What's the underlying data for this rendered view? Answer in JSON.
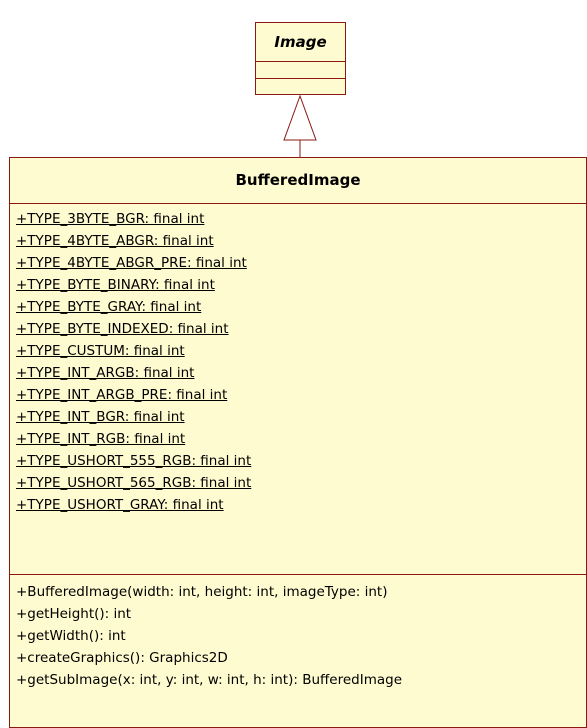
{
  "parent_class": {
    "name": "Image",
    "attributes": [],
    "operations": []
  },
  "child_class": {
    "name": "BufferedImage",
    "attributes": [
      "+TYPE_3BYTE_BGR: final int",
      "+TYPE_4BYTE_ABGR: final int",
      "+TYPE_4BYTE_ABGR_PRE: final int",
      "+TYPE_BYTE_BINARY: final int",
      "+TYPE_BYTE_GRAY: final int",
      "+TYPE_BYTE_INDEXED: final int",
      "+TYPE_CUSTUM: final int",
      "+TYPE_INT_ARGB: final int",
      "+TYPE_INT_ARGB_PRE: final int",
      "+TYPE_INT_BGR: final int",
      "+TYPE_INT_RGB: final int",
      "+TYPE_USHORT_555_RGB: final int",
      "+TYPE_USHORT_565_RGB: final int",
      "+TYPE_USHORT_GRAY: final int"
    ],
    "operations": [
      "+BufferedImage(width: int, height: int, imageType: int)",
      "+getHeight(): int",
      "+getWidth(): int",
      "+createGraphics(): Graphics2D",
      "+getSubImage(x: int, y: int, w: int, h: int): BufferedImage"
    ]
  },
  "relationship": {
    "type": "generalization"
  },
  "colors": {
    "class_fill": "#fffbd0",
    "class_border": "#8a1b14",
    "connector": "#8a1b14"
  }
}
